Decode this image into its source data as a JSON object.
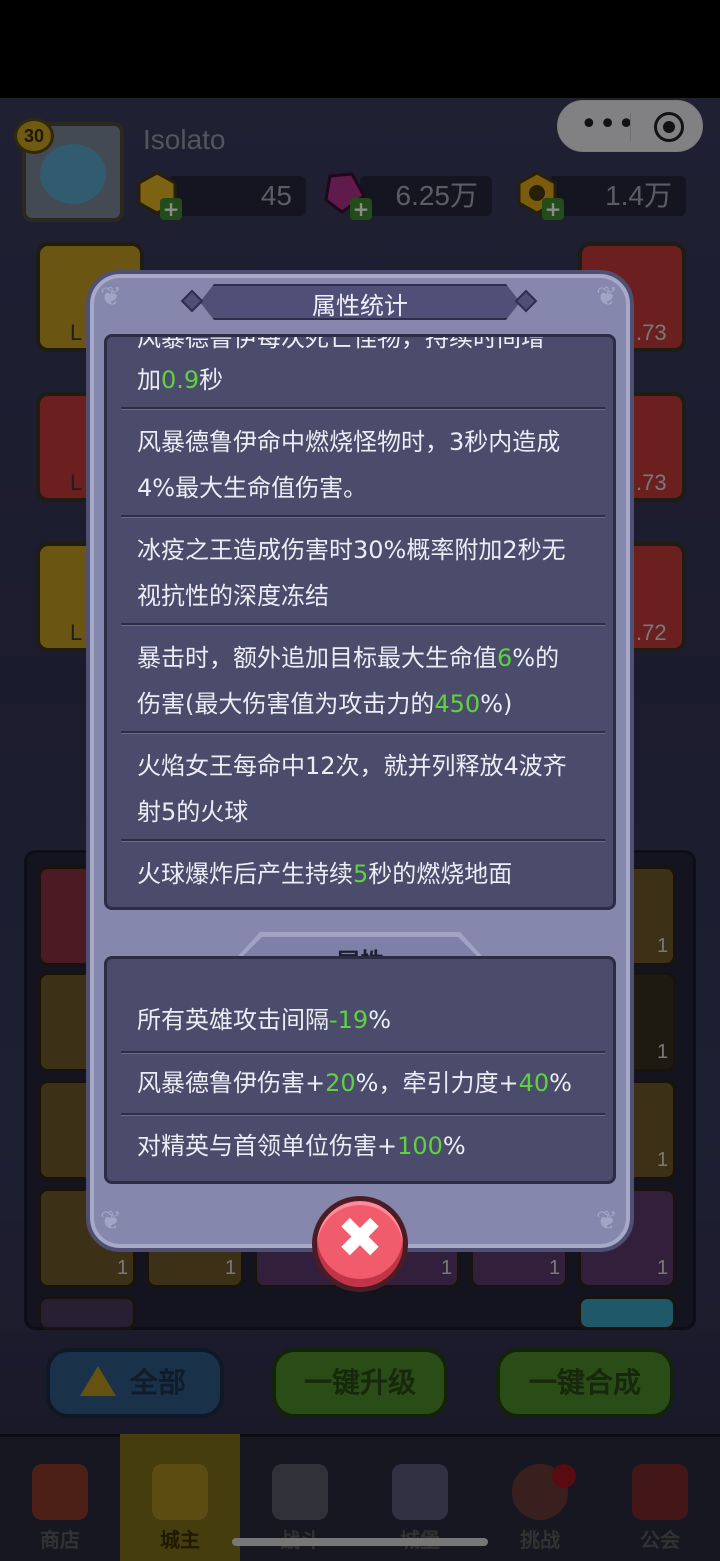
{
  "player": {
    "name": "Isolato",
    "level": "30"
  },
  "resources": [
    {
      "name": "gold",
      "value": "45",
      "color": "#e0b423"
    },
    {
      "name": "gem",
      "value": "6.25万",
      "color": "#b0328a"
    },
    {
      "name": "coin",
      "value": "1.4万",
      "color": "#e0a81c"
    }
  ],
  "side_slots": {
    "left_labels": [
      "L",
      "L",
      "L"
    ],
    "right_labels": [
      ".73",
      ".73",
      ".72"
    ]
  },
  "grid": {
    "counts": [
      "1",
      "1",
      "1",
      "1",
      "1",
      "1",
      "1",
      "1",
      "1"
    ]
  },
  "bottom_buttons": {
    "all": "全部",
    "upgrade": "一键升级",
    "merge": "一键合成"
  },
  "nav": {
    "shop": "商店",
    "lord": "城主",
    "battle": "战斗",
    "castle": "城堡",
    "challenge": "挑战",
    "guild": "公会"
  },
  "dialog": {
    "title": "属性统计",
    "stats": [
      {
        "parts": [
          "风暴德鲁伊每次死亡怪物，持续时间增"
        ]
      },
      {
        "parts": [
          "加",
          "0.9",
          "秒"
        ]
      },
      {
        "parts": [
          "风暴德鲁伊命中燃烧怪物时，3秒内造成"
        ]
      },
      {
        "parts": [
          "4%最大生命值伤害。"
        ]
      },
      {
        "parts": [
          "冰疫之王造成伤害时30%概率附加2秒无"
        ]
      },
      {
        "parts": [
          "视抗性的深度冻结"
        ]
      },
      {
        "parts": [
          "暴击时，额外追加目标最大生命值",
          "6",
          "%的"
        ]
      },
      {
        "parts": [
          "伤害(最大伤害值为攻击力的",
          "450",
          "%)"
        ]
      },
      {
        "parts": [
          "火焰女王每命中12次，就并列释放4波齐"
        ]
      },
      {
        "parts": [
          "射5的火球"
        ]
      },
      {
        "parts": [
          "火球爆炸后产生持续",
          "5",
          "秒的燃烧地面"
        ]
      }
    ],
    "section_title": "属性",
    "attributes": [
      {
        "parts": [
          "所有英雄攻击间隔",
          "-19",
          "%"
        ]
      },
      {
        "parts": [
          "风暴德鲁伊伤害+",
          "20",
          "%，牵引力度+",
          "40",
          "%"
        ]
      },
      {
        "parts": [
          "对精英与首领单位伤害+",
          "100",
          "%"
        ]
      }
    ],
    "close_icon": "close-x-icon",
    "highlight_color": "#5dd33e"
  }
}
